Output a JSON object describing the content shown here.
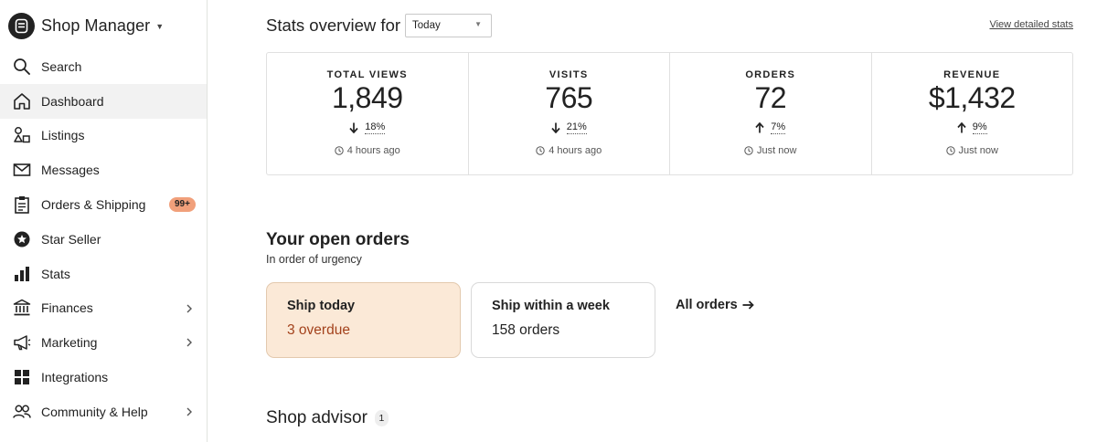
{
  "sidebar": {
    "title": "Shop Manager",
    "items": [
      {
        "label": "Search",
        "icon": "search-icon"
      },
      {
        "label": "Dashboard",
        "icon": "home-icon",
        "active": true
      },
      {
        "label": "Listings",
        "icon": "listings-icon"
      },
      {
        "label": "Messages",
        "icon": "envelope-icon"
      },
      {
        "label": "Orders & Shipping",
        "icon": "clipboard-icon",
        "badge": "99+"
      },
      {
        "label": "Star Seller",
        "icon": "star-badge-icon"
      },
      {
        "label": "Stats",
        "icon": "bar-chart-icon"
      },
      {
        "label": "Finances",
        "icon": "bank-icon",
        "has_submenu": true
      },
      {
        "label": "Marketing",
        "icon": "megaphone-icon",
        "has_submenu": true
      },
      {
        "label": "Integrations",
        "icon": "grid-icon"
      },
      {
        "label": "Community & Help",
        "icon": "people-icon",
        "has_submenu": true
      }
    ]
  },
  "stats": {
    "title": "Stats overview for",
    "period": "Today",
    "detail_link": "View detailed stats",
    "cards": [
      {
        "label": "TOTAL VIEWS",
        "value": "1,849",
        "direction": "down",
        "change": "18%",
        "updated": "4 hours ago"
      },
      {
        "label": "VISITS",
        "value": "765",
        "direction": "down",
        "change": "21%",
        "updated": "4 hours ago"
      },
      {
        "label": "ORDERS",
        "value": "72",
        "direction": "up",
        "change": "7%",
        "updated": "Just now"
      },
      {
        "label": "REVENUE",
        "value": "$1,432",
        "direction": "up",
        "change": "9%",
        "updated": "Just now"
      }
    ]
  },
  "orders": {
    "title": "Your open orders",
    "subtitle": "In order of urgency",
    "cards": [
      {
        "title": "Ship today",
        "value": "3 overdue"
      },
      {
        "title": "Ship within a week",
        "value": "158 orders"
      }
    ],
    "all_orders_link": "All orders"
  },
  "advisor": {
    "title": "Shop advisor",
    "count": "1"
  },
  "colors": {
    "urgent_bg": "#fbe9d7",
    "overdue_text": "#a3421c",
    "badge_bg": "#f1a07b",
    "active_nav_bg": "#f2f2f2"
  }
}
